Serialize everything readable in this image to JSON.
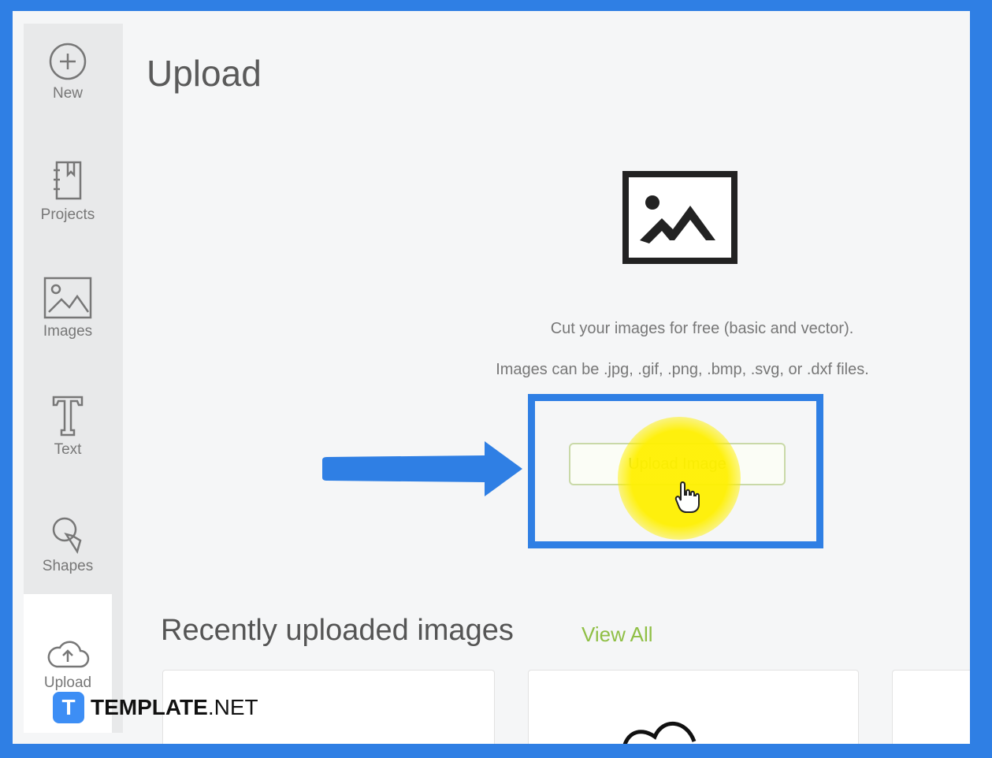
{
  "sidebar": {
    "items": [
      {
        "label": "New",
        "icon": "plus-circle-icon"
      },
      {
        "label": "Projects",
        "icon": "notebook-icon"
      },
      {
        "label": "Images",
        "icon": "image-icon"
      },
      {
        "label": "Text",
        "icon": "text-t-icon"
      },
      {
        "label": "Shapes",
        "icon": "shapes-icon"
      },
      {
        "label": "Upload",
        "icon": "cloud-upload-icon"
      }
    ],
    "active": "Upload"
  },
  "main": {
    "title": "Upload",
    "description_line1": "Cut your images for free (basic and vector).",
    "description_line2": "Images can be .jpg, .gif, .png, .bmp, .svg, or .dxf files.",
    "upload_button_label": "Upload Image",
    "recent_title": "Recently uploaded images",
    "view_all_label": "View All"
  },
  "watermark": {
    "badge": "T",
    "brand_bold": "TEMPLATE",
    "brand_suffix": ".NET"
  },
  "colors": {
    "frame_blue": "#2f7fe4",
    "accent_green": "#8fbf45",
    "highlight_yellow": "#fff000"
  }
}
